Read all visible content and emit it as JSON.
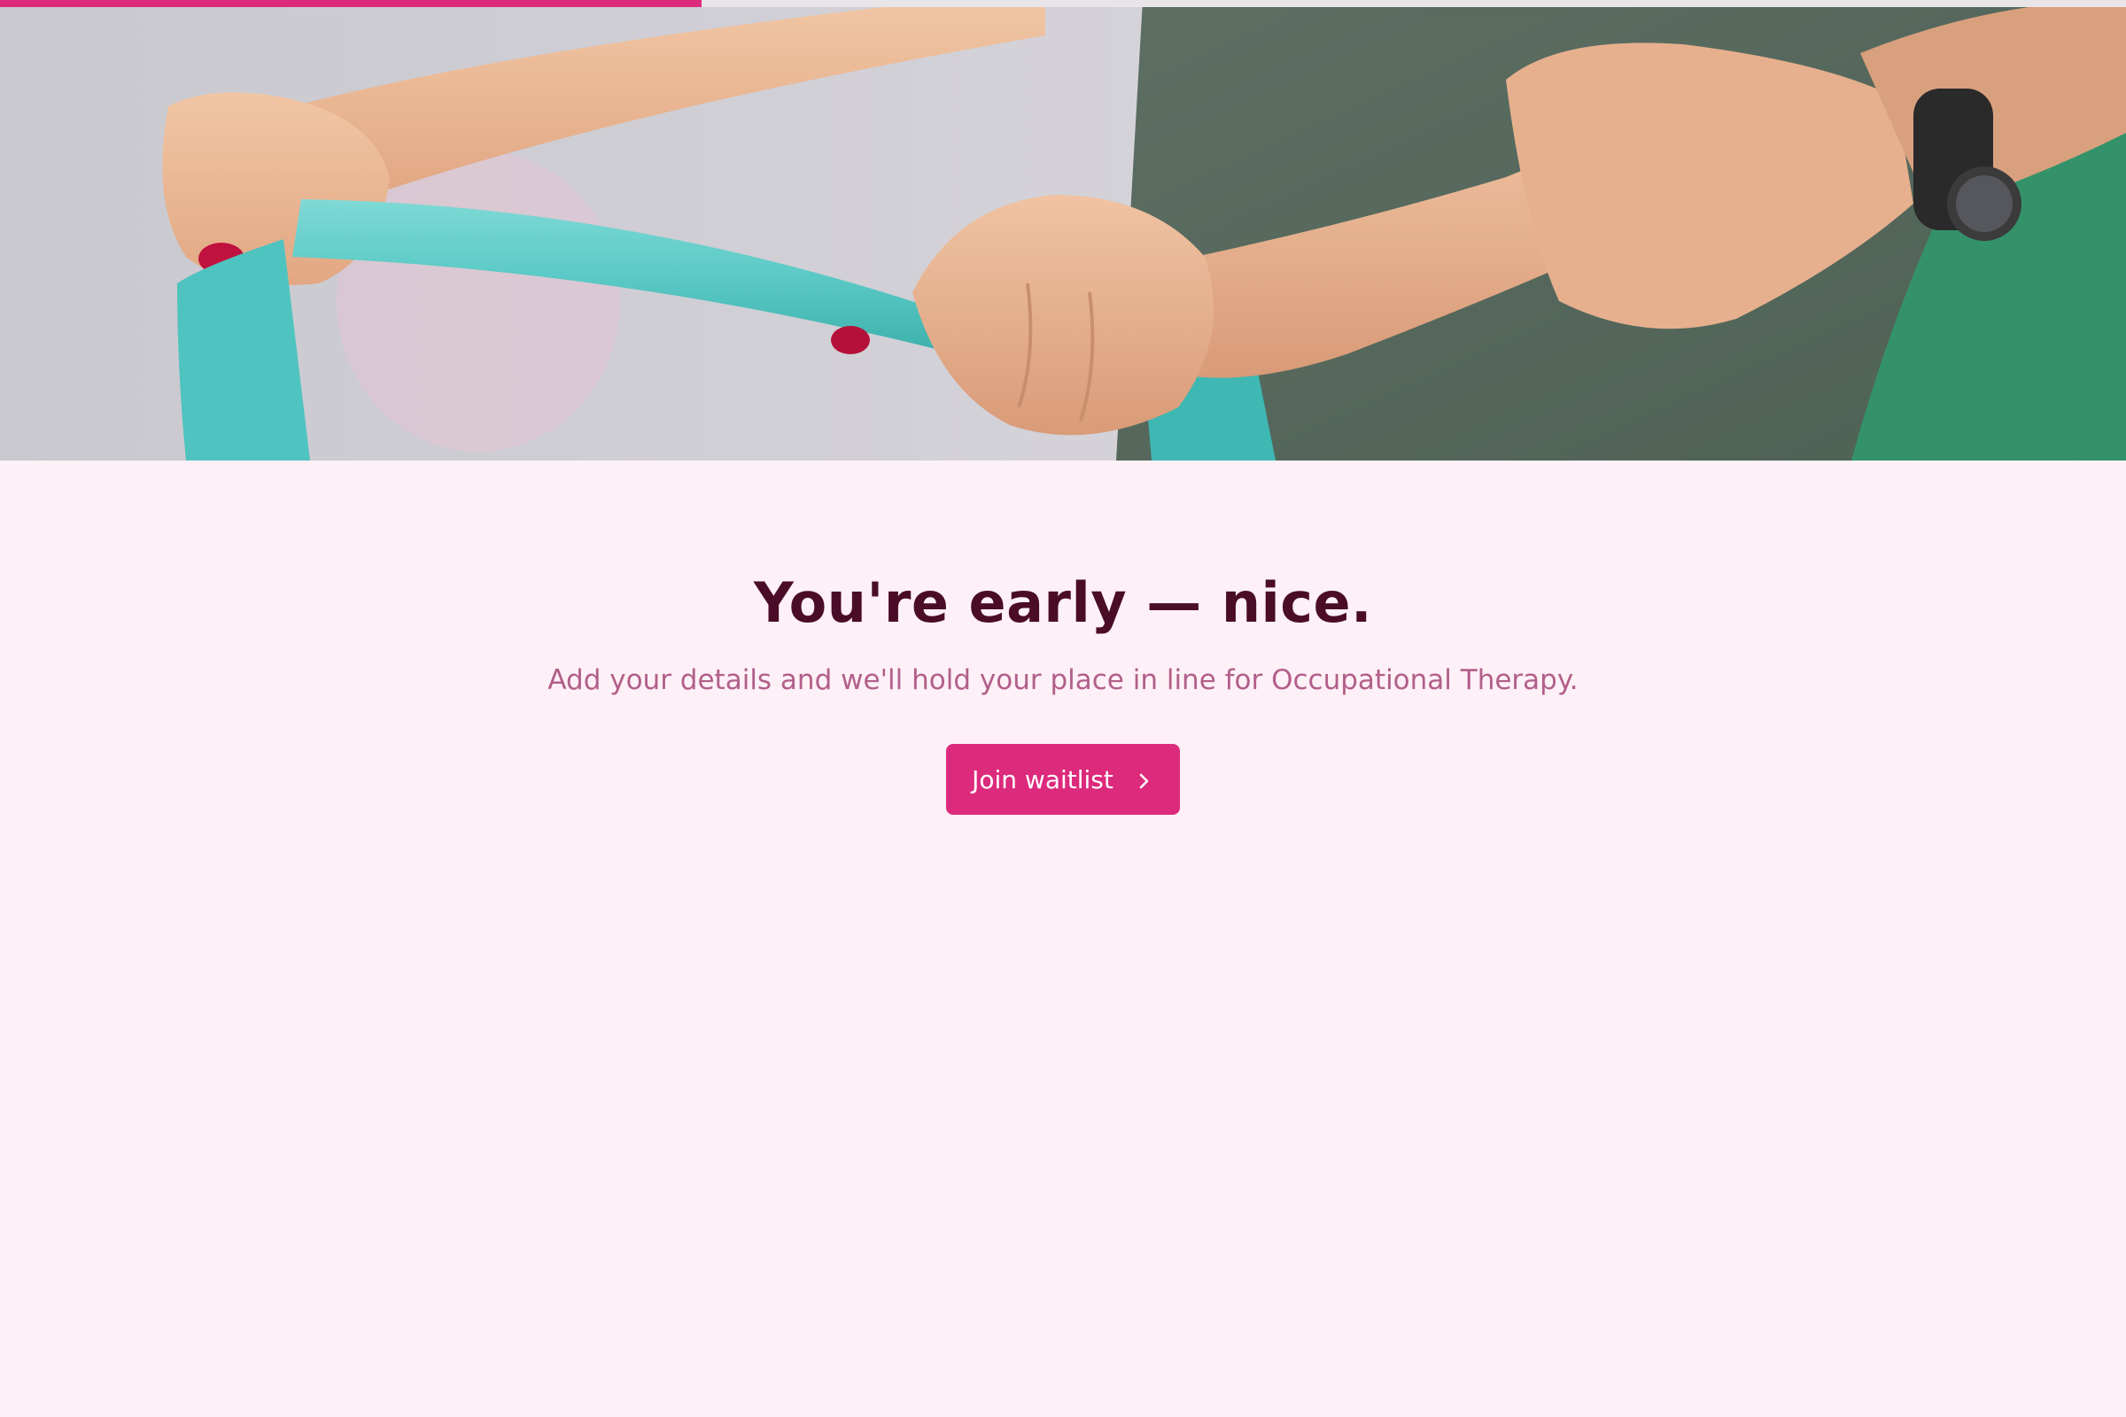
{
  "progress": {
    "value": 0.33,
    "color": "#dc2a7c"
  },
  "hero": {
    "alt": "Hands holding a teal resistance band during therapy"
  },
  "headline": "You're early — nice.",
  "subtext": "Add your details and we'll hold your place in line for Occupational Therapy.",
  "cta": {
    "label": "Join waitlist",
    "icon": "chevron-right-icon"
  },
  "colors": {
    "background": "#fdf0f6",
    "accent": "#dc2a7c",
    "headline": "#4a0c26",
    "subtext": "#b25f8a"
  }
}
